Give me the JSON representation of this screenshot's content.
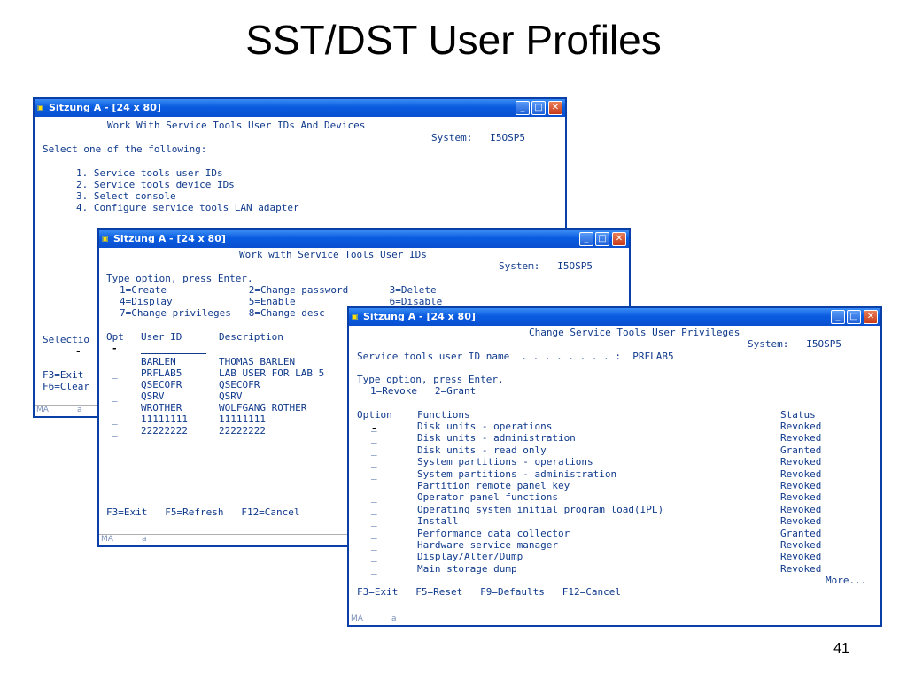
{
  "slide": {
    "title": "SST/DST User Profiles",
    "page_number": "41"
  },
  "window_title": "Sitzung A - [24 x 80]",
  "status_bar": {
    "mode": "MA",
    "field": "a"
  },
  "win1": {
    "heading": "Work With Service Tools User IDs And Devices",
    "system": "System:   I5OSP5",
    "prompt": "Select one of the following:",
    "options": [
      "1. Service tools user IDs",
      "2. Service tools device IDs",
      "3. Select console",
      "4. Configure service tools LAN adapter"
    ],
    "selection": "Selectio",
    "f3": "F3=Exit",
    "f6": "F6=Clear"
  },
  "win2": {
    "heading": "Work with Service Tools User IDs",
    "system": "System:   I5OSP5",
    "prompt": "Type option, press Enter.",
    "opt_lines": [
      "1=Create              2=Change password       3=Delete",
      "4=Display             5=Enable                6=Disable",
      "7=Change privileges   8=Change desc"
    ],
    "col_opt": "Opt",
    "col_user": "User ID",
    "col_desc": "Description",
    "rows": [
      {
        "opt": "_",
        "user": "BARLEN",
        "desc": "THOMAS BARLEN"
      },
      {
        "opt": "_",
        "user": "PRFLAB5",
        "desc": "LAB USER FOR LAB 5"
      },
      {
        "opt": "_",
        "user": "QSECOFR",
        "desc": "QSECOFR"
      },
      {
        "opt": "_",
        "user": "QSRV",
        "desc": "QSRV"
      },
      {
        "opt": "_",
        "user": "WROTHER",
        "desc": "WOLFGANG ROTHER"
      },
      {
        "opt": "_",
        "user": "11111111",
        "desc": "11111111"
      },
      {
        "opt": "_",
        "user": "22222222",
        "desc": "22222222"
      }
    ],
    "function_keys": "F3=Exit   F5=Refresh   F12=Cancel"
  },
  "win3": {
    "heading": "Change Service Tools User Privileges",
    "system": "System:   I5OSP5",
    "user_line": "Service tools user ID name  . . . . . . . . :  PRFLAB5",
    "prompt": "Type option, press Enter.",
    "opt_line": "1=Revoke   2=Grant",
    "col_option": "Option",
    "col_functions": "Functions",
    "col_status": "Status",
    "rows": [
      {
        "fn": "Disk units - operations",
        "status": "Revoked"
      },
      {
        "fn": "Disk units - administration",
        "status": "Revoked"
      },
      {
        "fn": "Disk units - read only",
        "status": "Granted"
      },
      {
        "fn": "System partitions - operations",
        "status": "Revoked"
      },
      {
        "fn": "System partitions - administration",
        "status": "Revoked"
      },
      {
        "fn": "Partition remote panel key",
        "status": "Revoked"
      },
      {
        "fn": "Operator panel functions",
        "status": "Revoked"
      },
      {
        "fn": "Operating system initial program load(IPL)",
        "status": "Revoked"
      },
      {
        "fn": "Install",
        "status": "Revoked"
      },
      {
        "fn": "Performance data collector",
        "status": "Granted"
      },
      {
        "fn": "Hardware service manager",
        "status": "Revoked"
      },
      {
        "fn": "Display/Alter/Dump",
        "status": "Revoked"
      },
      {
        "fn": "Main storage dump",
        "status": "Revoked"
      }
    ],
    "more": "More...",
    "function_keys": "F3=Exit   F5=Reset   F9=Defaults   F12=Cancel"
  }
}
